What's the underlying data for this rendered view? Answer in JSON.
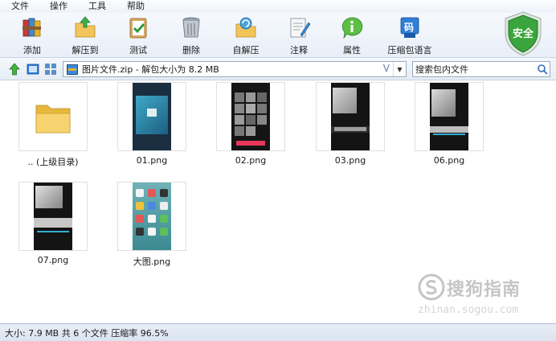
{
  "menu": [
    "文件",
    "操作",
    "工具",
    "帮助"
  ],
  "toolbar": {
    "buttons": [
      {
        "label": "添加",
        "icon": "archive-books-icon"
      },
      {
        "label": "解压到",
        "icon": "extract-folder-icon"
      },
      {
        "label": "测试",
        "icon": "clipboard-check-icon"
      },
      {
        "label": "删除",
        "icon": "trash-bin-icon"
      },
      {
        "label": "自解压",
        "icon": "self-extract-icon"
      },
      {
        "label": "注释",
        "icon": "notepad-pencil-icon"
      },
      {
        "label": "属性",
        "icon": "info-balloon-icon"
      },
      {
        "label": "压缩包语言",
        "icon": "language-code-icon"
      }
    ],
    "language_glyph": "码",
    "security_badge": "安全"
  },
  "address": {
    "path": "图片文件.zip - 解包大小为 8.2 MB",
    "v_glyph": "V"
  },
  "search": {
    "placeholder": "搜索包内文件"
  },
  "files": [
    {
      "name": ".. (上级目录)",
      "kind": "parent-folder"
    },
    {
      "name": "01.png",
      "kind": "image"
    },
    {
      "name": "02.png",
      "kind": "image"
    },
    {
      "name": "03.png",
      "kind": "image"
    },
    {
      "name": "06.png",
      "kind": "image"
    },
    {
      "name": "07.png",
      "kind": "image"
    },
    {
      "name": "大图.png",
      "kind": "image"
    }
  ],
  "status": "大小: 7.9 MB 共 6 个文件 压缩率 96.5%",
  "watermark": {
    "brand": "搜狗指南",
    "url": "zhinan.sogou.com"
  },
  "colors": {
    "accent": "#2a7fd0",
    "shield_green": "#3aa53c",
    "toolbar_bg": "#eef3fa"
  }
}
